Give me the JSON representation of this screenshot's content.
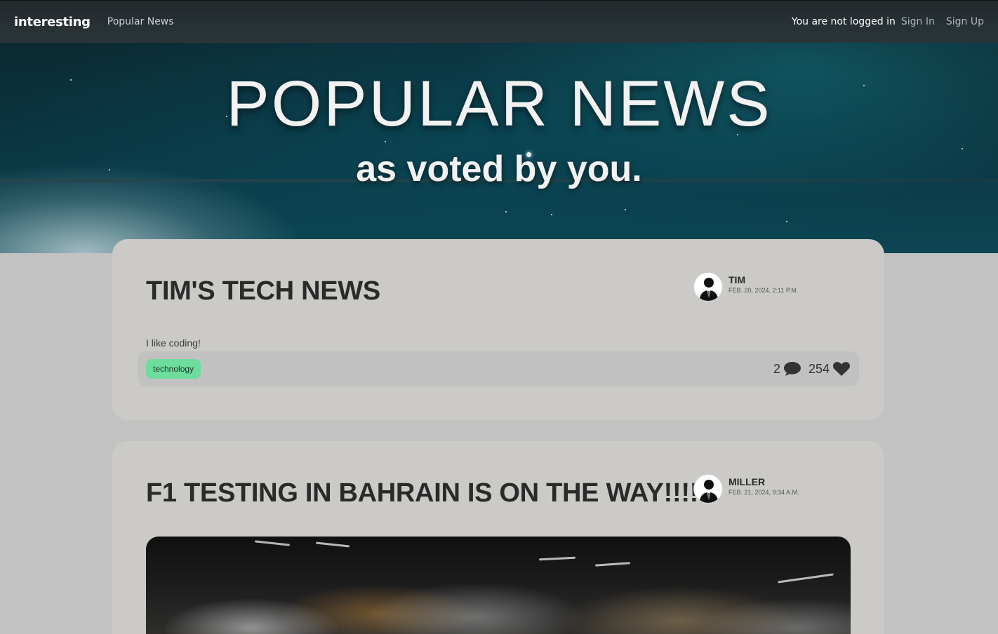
{
  "navbar": {
    "brand": "interesting",
    "link": "Popular News",
    "status": "You are not logged in",
    "sign_in": "Sign In",
    "sign_up": "Sign Up"
  },
  "hero": {
    "title": "POPULAR NEWS",
    "subtitle": "as voted by you."
  },
  "posts": [
    {
      "title": "TIM'S TECH NEWS",
      "author": "TIM",
      "date": "FEB. 20, 2024, 2:11 P.M.",
      "text": "I like coding!",
      "tag": "technology",
      "comments": "2",
      "likes": "254"
    },
    {
      "title": "F1 TESTING IN BAHRAIN IS ON THE WAY!!!!",
      "author": "MILLER",
      "date": "FEB. 21, 2024, 9:34 A.M."
    }
  ],
  "icons": {
    "comment": "comment-icon",
    "like": "heart-icon",
    "avatar": "user-silhouette-icon"
  },
  "colors": {
    "tag_bg": "#6ddc9c",
    "card_bg": "#cbcac7",
    "page_bg": "#c2c2c2",
    "navbar_bg": "#222a2e"
  }
}
